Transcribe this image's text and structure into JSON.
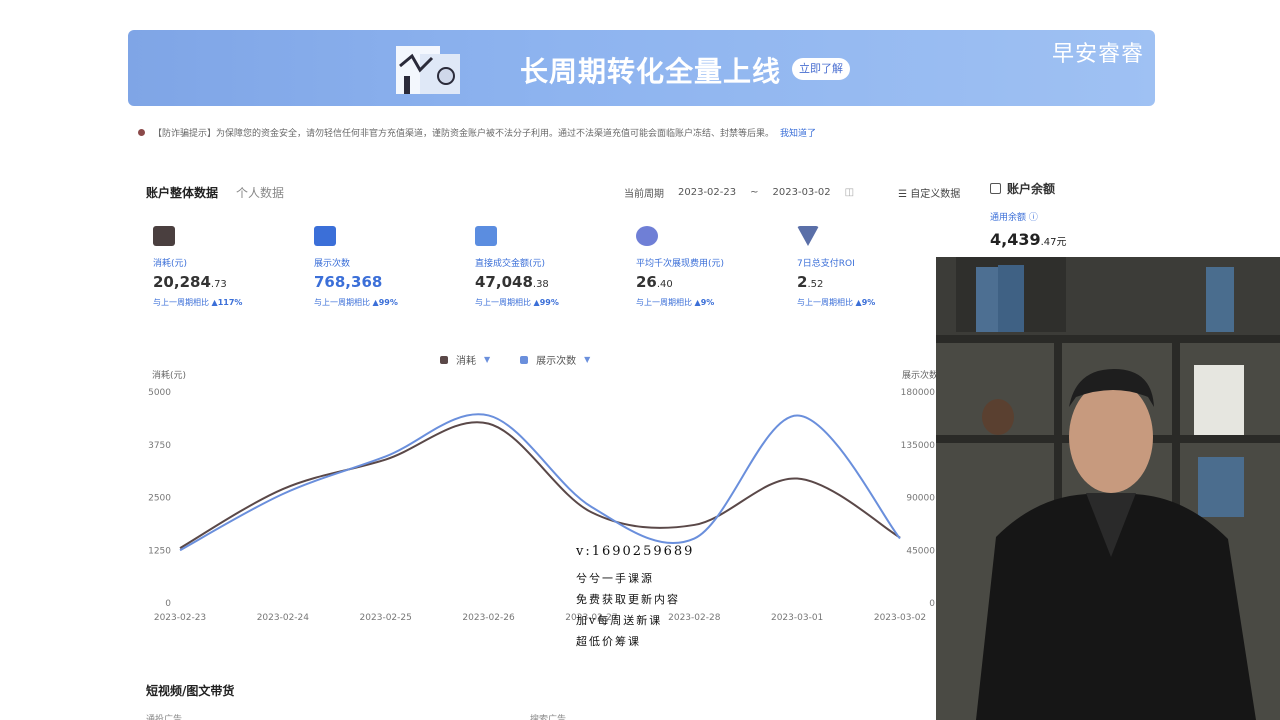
{
  "banner": {
    "headline": "长周期转化全量上线",
    "cta": "立即了解",
    "watermark": "早安睿睿"
  },
  "notice": {
    "text": "【防诈骗提示】为保障您的资金安全，请勿轻信任何非官方充值渠道，谨防资金账户被不法分子利用。通过不法渠道充值可能会面临账户冻结、封禁等后果。",
    "link": "我知道了"
  },
  "tabs": {
    "active": "账户整体数据",
    "other": "个人数据"
  },
  "period": {
    "label": "当前周期",
    "start": "2023-02-23",
    "sep": "~",
    "end": "2023-03-02",
    "custom": "自定义数据"
  },
  "balance": {
    "title": "账户余额",
    "label": "通用余额",
    "value_int": "4,439",
    "value_dec": ".47元"
  },
  "metrics": [
    {
      "label": "消耗(元)",
      "value_int": "20,284",
      "value_dec": ".73",
      "compare": "与上一周期相比",
      "change": "▲117%",
      "color": "#4a3f3f",
      "icon": "wallet-icon"
    },
    {
      "label": "展示次数",
      "value_int": "768,368",
      "value_dec": "",
      "compare": "与上一周期相比",
      "change": "▲99%",
      "color": "#3b6fd8",
      "icon": "play-icon"
    },
    {
      "label": "直接成交金额(元)",
      "value_int": "47,048",
      "value_dec": ".38",
      "compare": "与上一周期相比",
      "change": "▲99%",
      "color": "#5b8de0",
      "icon": "money-icon"
    },
    {
      "label": "平均千次展现费用(元)",
      "value_int": "26",
      "value_dec": ".40",
      "compare": "与上一周期相比",
      "change": "▲9%",
      "color": "#6f7fd6",
      "icon": "cpm-icon"
    },
    {
      "label": "7日总支付ROI",
      "value_int": "2",
      "value_dec": ".52",
      "compare": "与上一周期相比",
      "change": "▲9%",
      "color": "#5a6fa8",
      "icon": "roi-icon"
    }
  ],
  "chart_data": {
    "type": "line",
    "legend": [
      "消耗",
      "展示次数"
    ],
    "x": [
      "2023-02-23",
      "2023-02-24",
      "2023-02-25",
      "2023-02-26",
      "2023-02-27",
      "2023-02-28",
      "2023-03-01",
      "2023-03-02"
    ],
    "series": [
      {
        "name": "消耗",
        "axis": "left",
        "color": "#5a4848",
        "values": [
          1300,
          2700,
          3400,
          4250,
          2150,
          1850,
          2950,
          1550
        ]
      },
      {
        "name": "展示次数",
        "axis": "right",
        "color": "#6a8fdc",
        "values": [
          45000,
          93000,
          125000,
          160000,
          82000,
          55000,
          160000,
          55000
        ]
      }
    ],
    "ylabel_left": "消耗(元)",
    "ylabel_right": "展示次数",
    "yticks_left": [
      0,
      1250,
      2500,
      3750,
      5000
    ],
    "yticks_right": [
      0,
      45000,
      90000,
      135000,
      180000
    ],
    "ylim_left": [
      0,
      5000
    ],
    "ylim_right": [
      0,
      180000
    ],
    "grid": false
  },
  "overlay": {
    "line1": "v:1690259689",
    "line2": "兮兮一手课源",
    "line3": "免费获取更新内容",
    "line4": "加v每周送新课",
    "line5": "超低价筹课"
  },
  "section": {
    "title": "短视频/图文带货",
    "left_sub": "通投广告",
    "right_sub": "搜索广告"
  }
}
